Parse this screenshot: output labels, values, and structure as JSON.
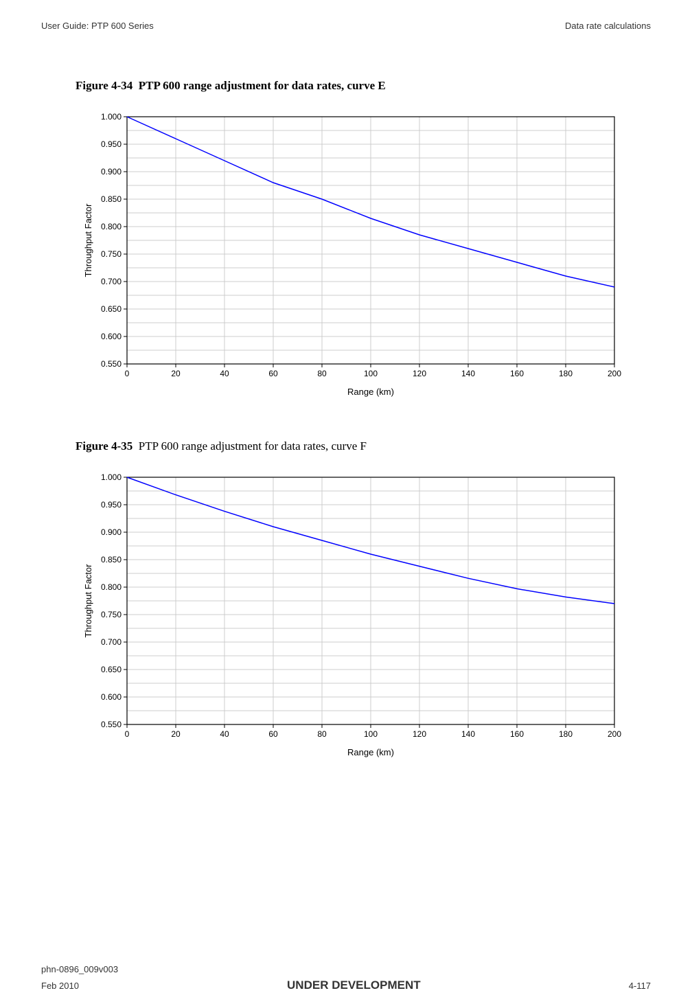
{
  "header": {
    "left": "User Guide: PTP 600 Series",
    "right": "Data rate calculations"
  },
  "figure1": {
    "label": "Figure 4-34",
    "title": "PTP 600 range adjustment for data rates, curve E"
  },
  "figure2": {
    "label": "Figure 4-35",
    "title": "PTP 600 range adjustment for data rates, curve F"
  },
  "axes": {
    "xlabel": "Range (km)",
    "ylabel": "Throughput Factor"
  },
  "footer": {
    "docid": "phn-0896_009v003",
    "date": "Feb 2010",
    "center": "UNDER DEVELOPMENT",
    "page": "4-117"
  },
  "chart_data": [
    {
      "type": "line",
      "title": "PTP 600 range adjustment for data rates, curve E",
      "xlabel": "Range (km)",
      "ylabel": "Throughput Factor",
      "xlim": [
        0,
        200
      ],
      "ylim": [
        0.55,
        1.0
      ],
      "x_ticks": [
        0,
        20,
        40,
        60,
        80,
        100,
        120,
        140,
        160,
        180,
        200
      ],
      "y_ticks": [
        0.55,
        0.6,
        0.65,
        0.7,
        0.75,
        0.8,
        0.85,
        0.9,
        0.95,
        1.0
      ],
      "series": [
        {
          "name": "Curve E",
          "x": [
            0,
            20,
            40,
            60,
            80,
            100,
            120,
            140,
            160,
            180,
            200
          ],
          "values": [
            1.0,
            0.96,
            0.92,
            0.88,
            0.85,
            0.815,
            0.785,
            0.76,
            0.735,
            0.71,
            0.69
          ]
        }
      ]
    },
    {
      "type": "line",
      "title": "PTP 600 range adjustment for data rates, curve F",
      "xlabel": "Range (km)",
      "ylabel": "Throughput Factor",
      "xlim": [
        0,
        200
      ],
      "ylim": [
        0.55,
        1.0
      ],
      "x_ticks": [
        0,
        20,
        40,
        60,
        80,
        100,
        120,
        140,
        160,
        180,
        200
      ],
      "y_ticks": [
        0.55,
        0.6,
        0.65,
        0.7,
        0.75,
        0.8,
        0.85,
        0.9,
        0.95,
        1.0
      ],
      "series": [
        {
          "name": "Curve F",
          "x": [
            0,
            20,
            40,
            60,
            80,
            100,
            120,
            140,
            160,
            180,
            200
          ],
          "values": [
            1.0,
            0.968,
            0.938,
            0.91,
            0.885,
            0.86,
            0.838,
            0.816,
            0.797,
            0.782,
            0.77
          ]
        }
      ]
    }
  ]
}
